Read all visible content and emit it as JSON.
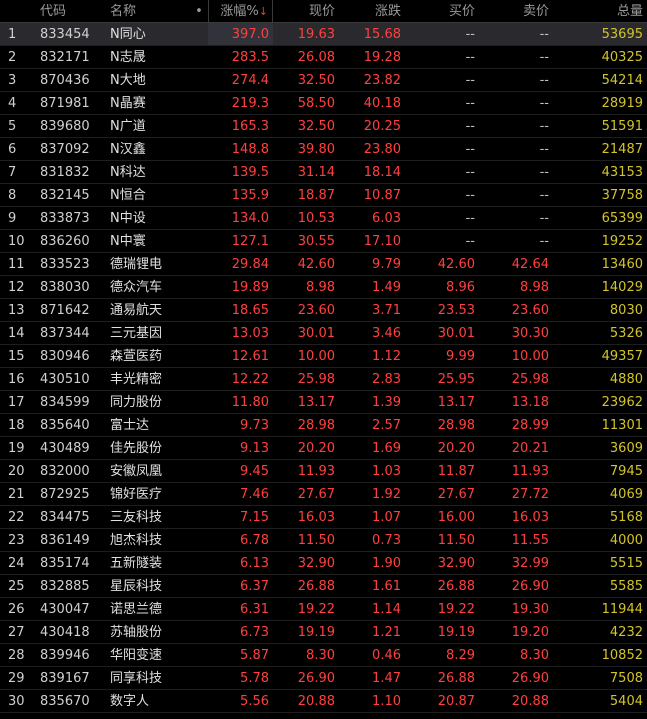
{
  "columns": {
    "index": "",
    "code": "代码",
    "name": "名称",
    "dot": "•",
    "change_pct": "涨幅%",
    "sort_arrow": "↓",
    "price": "现价",
    "change": "涨跌",
    "bid": "买价",
    "ask": "卖价",
    "volume": "总量"
  },
  "selected_row": 1,
  "colors": {
    "up": "#ff4040",
    "volume": "#d2c42a",
    "text": "#c8c8c8",
    "background": "#000000"
  },
  "rows": [
    {
      "idx": "1",
      "code": "833454",
      "name": "N同心",
      "pct": "397.0",
      "price": "19.63",
      "chg": "15.68",
      "bid": "--",
      "ask": "--",
      "vol": "53695"
    },
    {
      "idx": "2",
      "code": "832171",
      "name": "N志晟",
      "pct": "283.5",
      "price": "26.08",
      "chg": "19.28",
      "bid": "--",
      "ask": "--",
      "vol": "40325"
    },
    {
      "idx": "3",
      "code": "870436",
      "name": "N大地",
      "pct": "274.4",
      "price": "32.50",
      "chg": "23.82",
      "bid": "--",
      "ask": "--",
      "vol": "54214"
    },
    {
      "idx": "4",
      "code": "871981",
      "name": "N晶赛",
      "pct": "219.3",
      "price": "58.50",
      "chg": "40.18",
      "bid": "--",
      "ask": "--",
      "vol": "28919"
    },
    {
      "idx": "5",
      "code": "839680",
      "name": "N广道",
      "pct": "165.3",
      "price": "32.50",
      "chg": "20.25",
      "bid": "--",
      "ask": "--",
      "vol": "51591"
    },
    {
      "idx": "6",
      "code": "837092",
      "name": "N汉鑫",
      "pct": "148.8",
      "price": "39.80",
      "chg": "23.80",
      "bid": "--",
      "ask": "--",
      "vol": "21487"
    },
    {
      "idx": "7",
      "code": "831832",
      "name": "N科达",
      "pct": "139.5",
      "price": "31.14",
      "chg": "18.14",
      "bid": "--",
      "ask": "--",
      "vol": "43153"
    },
    {
      "idx": "8",
      "code": "832145",
      "name": "N恒合",
      "pct": "135.9",
      "price": "18.87",
      "chg": "10.87",
      "bid": "--",
      "ask": "--",
      "vol": "37758"
    },
    {
      "idx": "9",
      "code": "833873",
      "name": "N中设",
      "pct": "134.0",
      "price": "10.53",
      "chg": "6.03",
      "bid": "--",
      "ask": "--",
      "vol": "65399"
    },
    {
      "idx": "10",
      "code": "836260",
      "name": "N中寰",
      "pct": "127.1",
      "price": "30.55",
      "chg": "17.10",
      "bid": "--",
      "ask": "--",
      "vol": "19252"
    },
    {
      "idx": "11",
      "code": "833523",
      "name": "德瑞锂电",
      "pct": "29.84",
      "price": "42.60",
      "chg": "9.79",
      "bid": "42.60",
      "ask": "42.64",
      "vol": "13460"
    },
    {
      "idx": "12",
      "code": "838030",
      "name": "德众汽车",
      "pct": "19.89",
      "price": "8.98",
      "chg": "1.49",
      "bid": "8.96",
      "ask": "8.98",
      "vol": "14029"
    },
    {
      "idx": "13",
      "code": "871642",
      "name": "通易航天",
      "pct": "18.65",
      "price": "23.60",
      "chg": "3.71",
      "bid": "23.53",
      "ask": "23.60",
      "vol": "8030"
    },
    {
      "idx": "14",
      "code": "837344",
      "name": "三元基因",
      "pct": "13.03",
      "price": "30.01",
      "chg": "3.46",
      "bid": "30.01",
      "ask": "30.30",
      "vol": "5326"
    },
    {
      "idx": "15",
      "code": "830946",
      "name": "森萱医药",
      "pct": "12.61",
      "price": "10.00",
      "chg": "1.12",
      "bid": "9.99",
      "ask": "10.00",
      "vol": "49357"
    },
    {
      "idx": "16",
      "code": "430510",
      "name": "丰光精密",
      "pct": "12.22",
      "price": "25.98",
      "chg": "2.83",
      "bid": "25.95",
      "ask": "25.98",
      "vol": "4880"
    },
    {
      "idx": "17",
      "code": "834599",
      "name": "同力股份",
      "pct": "11.80",
      "price": "13.17",
      "chg": "1.39",
      "bid": "13.17",
      "ask": "13.18",
      "vol": "23962"
    },
    {
      "idx": "18",
      "code": "835640",
      "name": "富士达",
      "pct": "9.73",
      "price": "28.98",
      "chg": "2.57",
      "bid": "28.98",
      "ask": "28.99",
      "vol": "11301"
    },
    {
      "idx": "19",
      "code": "430489",
      "name": "佳先股份",
      "pct": "9.13",
      "price": "20.20",
      "chg": "1.69",
      "bid": "20.20",
      "ask": "20.21",
      "vol": "3609"
    },
    {
      "idx": "20",
      "code": "832000",
      "name": "安徽凤凰",
      "pct": "9.45",
      "price": "11.93",
      "chg": "1.03",
      "bid": "11.87",
      "ask": "11.93",
      "vol": "7945"
    },
    {
      "idx": "21",
      "code": "872925",
      "name": "锦好医疗",
      "pct": "7.46",
      "price": "27.67",
      "chg": "1.92",
      "bid": "27.67",
      "ask": "27.72",
      "vol": "4069"
    },
    {
      "idx": "22",
      "code": "834475",
      "name": "三友科技",
      "pct": "7.15",
      "price": "16.03",
      "chg": "1.07",
      "bid": "16.00",
      "ask": "16.03",
      "vol": "5168"
    },
    {
      "idx": "23",
      "code": "836149",
      "name": "旭杰科技",
      "pct": "6.78",
      "price": "11.50",
      "chg": "0.73",
      "bid": "11.50",
      "ask": "11.55",
      "vol": "4000"
    },
    {
      "idx": "24",
      "code": "835174",
      "name": "五新隧装",
      "pct": "6.13",
      "price": "32.90",
      "chg": "1.90",
      "bid": "32.90",
      "ask": "32.99",
      "vol": "5515"
    },
    {
      "idx": "25",
      "code": "832885",
      "name": "星辰科技",
      "pct": "6.37",
      "price": "26.88",
      "chg": "1.61",
      "bid": "26.88",
      "ask": "26.90",
      "vol": "5585"
    },
    {
      "idx": "26",
      "code": "430047",
      "name": "诺思兰德",
      "pct": "6.31",
      "price": "19.22",
      "chg": "1.14",
      "bid": "19.22",
      "ask": "19.30",
      "vol": "11944"
    },
    {
      "idx": "27",
      "code": "430418",
      "name": "苏轴股份",
      "pct": "6.73",
      "price": "19.19",
      "chg": "1.21",
      "bid": "19.19",
      "ask": "19.20",
      "vol": "4232"
    },
    {
      "idx": "28",
      "code": "839946",
      "name": "华阳变速",
      "pct": "5.87",
      "price": "8.30",
      "chg": "0.46",
      "bid": "8.29",
      "ask": "8.30",
      "vol": "10852"
    },
    {
      "idx": "29",
      "code": "839167",
      "name": "同享科技",
      "pct": "5.78",
      "price": "26.90",
      "chg": "1.47",
      "bid": "26.88",
      "ask": "26.90",
      "vol": "7508"
    },
    {
      "idx": "30",
      "code": "835670",
      "name": "数字人",
      "pct": "5.56",
      "price": "20.88",
      "chg": "1.10",
      "bid": "20.87",
      "ask": "20.88",
      "vol": "5404"
    }
  ]
}
